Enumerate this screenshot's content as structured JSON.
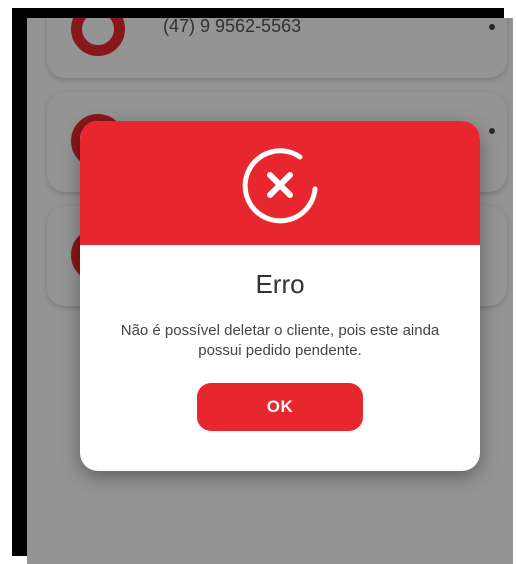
{
  "background": {
    "cards": [
      {
        "phone": "(47) 9 9562-5563"
      },
      {
        "phone": ""
      },
      {
        "phone": ""
      }
    ]
  },
  "dialog": {
    "icon": "close-circle-icon",
    "title": "Erro",
    "message": "Não é possível deletar o cliente, pois este ainda possui pedido pendente.",
    "ok_label": "OK"
  },
  "colors": {
    "accent": "#e8262e",
    "overlay": "rgba(0,0,0,0.42)"
  }
}
